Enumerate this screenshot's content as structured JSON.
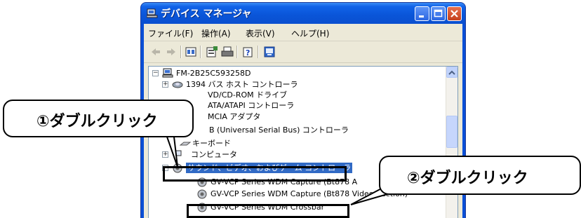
{
  "window": {
    "title": "デバイス マネージャ"
  },
  "menu": [
    "ファイル(F)",
    "操作(A)",
    "表示(V)",
    "ヘルプ(H)"
  ],
  "toolbar_icons": [
    "back-arrow-icon",
    "forward-arrow-icon",
    "view-icon",
    "properties-icon",
    "print-icon",
    "help-icon",
    "scan-hardware-icon"
  ],
  "tree": {
    "root": "FM-2B25C593258D",
    "items": [
      "1394 バス ホスト コントローラ",
      "VD/CD-ROM ドライブ",
      "ATA/ATAPI コントローラ",
      "MCIA アダプタ",
      "B (Universal Serial Bus) コントローラ",
      "キーボード",
      "コンピュータ"
    ],
    "selected": "サウンド、ビデオ、およびゲーム コントローラ",
    "children": [
      "GV-VCP Series WDM Capture (Bt878 A",
      "GV-VCP Series WDM Capture (Bt878 Video Section)",
      "GV-VCP Series WDM Crossbar"
    ]
  },
  "annotations": {
    "callout1": "①ダブルクリック",
    "callout2": "②ダブルクリック"
  }
}
